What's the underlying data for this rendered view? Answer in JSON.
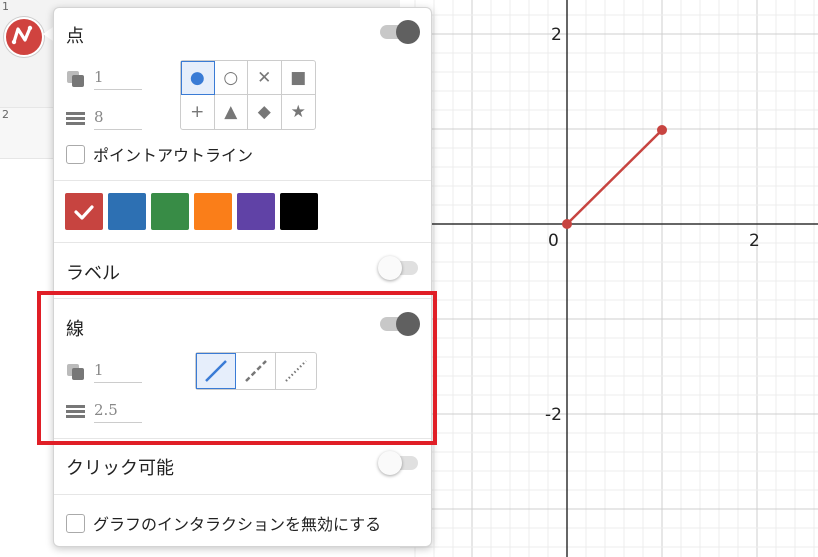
{
  "expression_list": {
    "rows": [
      {
        "index": "1"
      },
      {
        "index": "2"
      }
    ]
  },
  "popup": {
    "point_section": {
      "title": "点",
      "toggle_on": true,
      "opacity_value": "1",
      "size_value": "8",
      "point_styles": [
        "●",
        "○",
        "✕",
        "■",
        "+",
        "▲",
        "◆",
        "★"
      ],
      "selected_style": "●",
      "outline_label": "ポイントアウトライン"
    },
    "colors": {
      "swatches": [
        "#c74440",
        "#2d70b3",
        "#388c46",
        "#fa7e19",
        "#6042a6",
        "#000000"
      ],
      "selected": "#c74440"
    },
    "label_section": {
      "title": "ラベル",
      "toggle_on": false
    },
    "line_section": {
      "title": "線",
      "toggle_on": true,
      "opacity_value": "1",
      "width_value": "2.5",
      "line_styles": [
        "solid",
        "dashed",
        "dotted"
      ],
      "selected_style": "solid"
    },
    "clickable_section": {
      "title": "クリック可能",
      "toggle_on": false
    },
    "disable_interaction_label": "グラフのインタラクションを無効にする"
  },
  "graph": {
    "x_tick_labels": [
      "0",
      "2"
    ],
    "y_tick_labels": [
      "2",
      "-2"
    ],
    "segment": {
      "start": [
        0,
        0
      ],
      "end": [
        1,
        1
      ],
      "color": "#c74440"
    }
  }
}
